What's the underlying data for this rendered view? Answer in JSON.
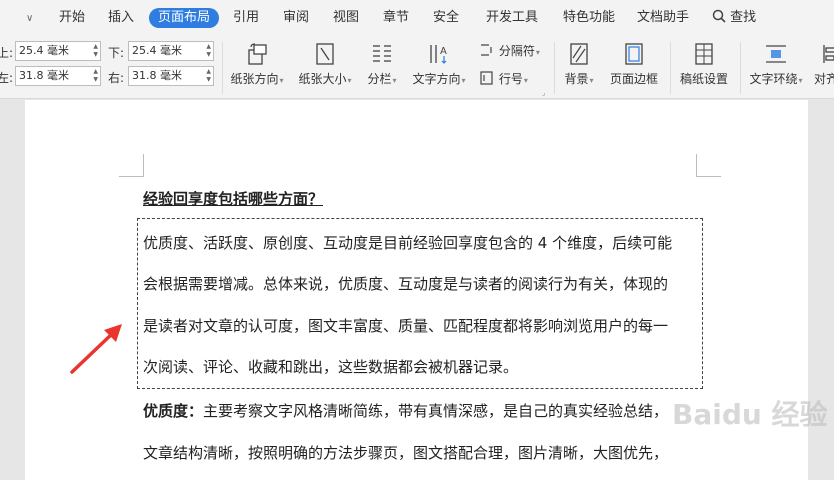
{
  "menu": {
    "quick_icon": "chevron-down-icon",
    "tabs": [
      "开始",
      "插入",
      "页面布局",
      "引用",
      "审阅",
      "视图",
      "章节",
      "安全",
      "开发工具",
      "特色功能",
      "文档助手"
    ],
    "active_tab": "页面布局",
    "search_label": "查找"
  },
  "ribbon": {
    "margins": {
      "top_label": "上:",
      "top_value": "25.4 毫米",
      "bottom_label": "下:",
      "bottom_value": "25.4 毫米",
      "left_label": "左:",
      "left_value": "31.8 毫米",
      "right_label": "右:",
      "right_value": "31.8 毫米"
    },
    "paper_orientation": "纸张方向",
    "paper_size": "纸张大小",
    "columns": "分栏",
    "text_direction": "文字方向",
    "separator": "分隔符",
    "line_numbers": "行号",
    "background": "背景",
    "page_border": "页面边框",
    "manuscript_settings": "稿纸设置",
    "text_wrap": "文字环绕",
    "align": "对齐"
  },
  "document": {
    "heading": "经验回享度包括哪些方面？",
    "quote_lines": [
      "优质度、活跃度、原创度、互动度是目前经验回享度包含的 4 个维度，后续可能",
      "会根据需要增减。总体来说，优质度、互动度是与读者的阅读行为有关，体现的",
      "是读者对文章的认可度，图文丰富度、质量、匹配程度都将影响浏览用户的每一",
      "次阅读、评论、收藏和跳出，这些数据都会被机器记录。"
    ],
    "para2_bold": "优质度：",
    "para2_line1": "主要考察文字风格清晰简练，带有真情深感，是自己的真实经验总结，",
    "para2_line2": "文章结构清晰，按照明确的方法步骤页，图文搭配合理，图片清晰，大图优先，"
  },
  "watermark": "Baidu 经验",
  "colors": {
    "accent": "#2f7de1",
    "arrow": "#e8352e"
  }
}
